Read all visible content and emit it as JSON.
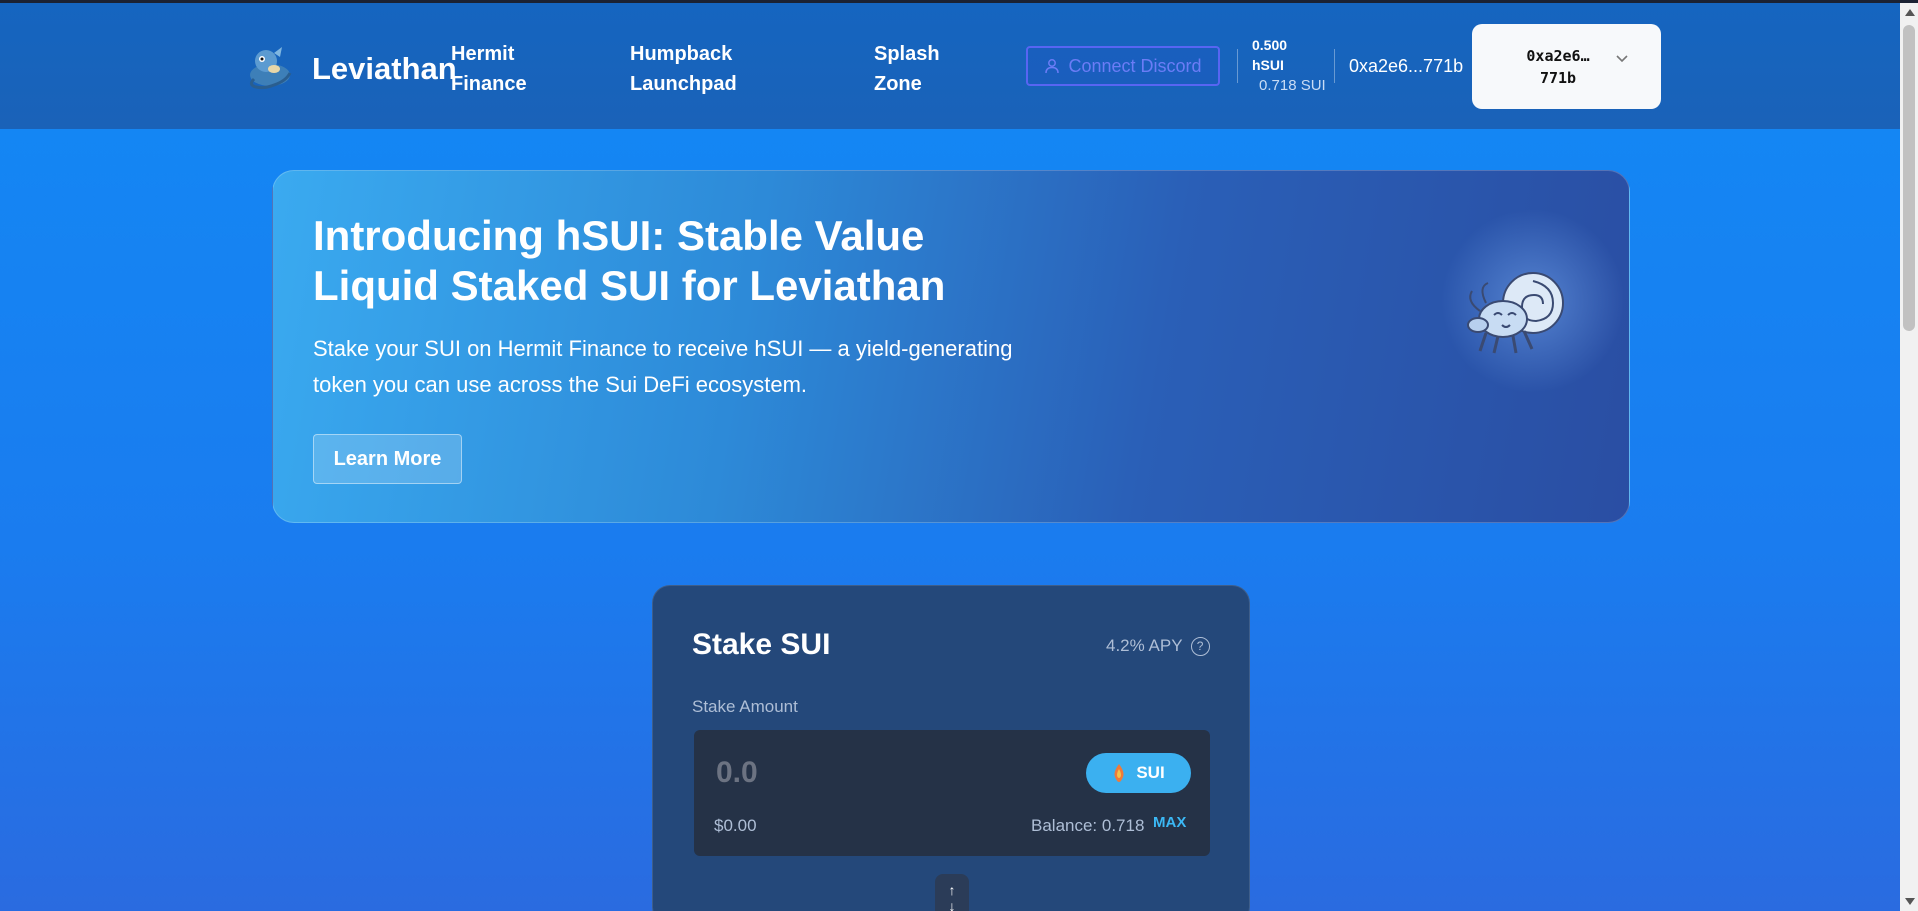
{
  "header": {
    "brand": "Leviathan",
    "nav": [
      "Hermit\nFinance",
      "Humpback\nLaunchpad",
      "Splash\nZone"
    ],
    "nav_items": [
      {
        "line1": "Hermit",
        "line2": "Finance"
      },
      {
        "line1": "Humpback",
        "line2": "Launchpad"
      },
      {
        "line1": "Splash",
        "line2": "Zone"
      }
    ],
    "discord_label": "Connect Discord",
    "balance_hsui_value": "0.500",
    "balance_hsui_unit": "hSUI",
    "balance_sui": "0.718 SUI",
    "address_short": "0xa2e6...771b",
    "wallet": {
      "line1": "0xa2e6…",
      "line2": "771b"
    }
  },
  "hero": {
    "title": "Introducing hSUI: Stable Value Liquid Staked SUI for Leviathan",
    "subtitle": "Stake your SUI on Hermit Finance to receive hSUI — a yield-generating token you can use across the Sui DeFi ecosystem.",
    "button_label": "Learn More"
  },
  "stake": {
    "title": "Stake SUI",
    "apy": "4.2% APY",
    "amount_label": "Stake Amount",
    "amount_placeholder": "0.0",
    "token": "SUI",
    "usd_value": "$0.00",
    "balance": "Balance: 0.718",
    "max_label": "MAX"
  },
  "icons": {
    "logo": "sea-dragon-logo-icon",
    "discord_user": "user-icon",
    "chevron": "chevron-down-icon",
    "help": "help-icon",
    "token": "sui-token-icon",
    "swap": "swap-arrows-icon"
  },
  "colors": {
    "header_bg": "#1565c0",
    "page_bg": "#1289f5",
    "discord_accent": "#5865f2",
    "card_bg": "#24487a",
    "token_pill": "#3bb0f0"
  }
}
